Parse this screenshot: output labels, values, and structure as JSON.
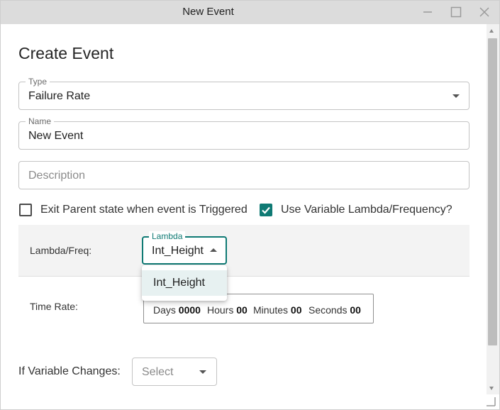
{
  "window": {
    "title": "New Event",
    "controls": {
      "minimize_icon": "minimize-icon",
      "maximize_icon": "maximize-icon",
      "close_icon": "close-icon"
    }
  },
  "form": {
    "heading": "Create Event",
    "type": {
      "label": "Type",
      "value": "Failure Rate"
    },
    "name": {
      "label": "Name",
      "value": "New Event"
    },
    "description": {
      "placeholder": "Description",
      "value": ""
    },
    "exit_parent": {
      "label": "Exit Parent state when event is Triggered",
      "checked": false
    },
    "use_variable": {
      "label": "Use Variable Lambda/Frequency?",
      "checked": true
    },
    "lambda_row": {
      "row_label": "Lambda/Freq:",
      "select_label": "Lambda",
      "select_value": "Int_Height",
      "options": [
        "Int_Height"
      ]
    },
    "time_rate": {
      "row_label": "Time Rate:",
      "days_label": "Days",
      "days_value": "0000",
      "hours_label": "Hours",
      "hours_value": "00",
      "minutes_label": "Minutes",
      "minutes_value": "00",
      "seconds_label": "Seconds",
      "seconds_value": "00"
    },
    "if_variable_changes": {
      "row_label": "If Variable Changes:",
      "placeholder": "Select"
    }
  },
  "colors": {
    "accent": "#0f7a74",
    "titlebar": "#dcdcdc",
    "band": "#f3f3f3",
    "menu_highlight": "#e7f1f1"
  }
}
